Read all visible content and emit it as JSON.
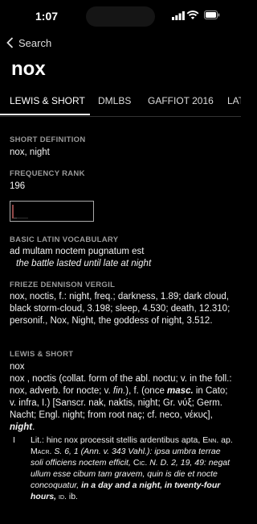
{
  "status": {
    "time": "1:07"
  },
  "nav": {
    "back_label": "Search"
  },
  "headword": "nox",
  "tabs": [
    {
      "label": "LEWIS & SHORT"
    },
    {
      "label": "DMLBS"
    },
    {
      "label": "GAFFIOT 2016"
    },
    {
      "label": "LAT"
    }
  ],
  "sections": {
    "short_def": {
      "label": "SHORT DEFINITION",
      "value": "nox, night"
    },
    "freq": {
      "label": "FREQUENCY RANK",
      "value": "196"
    },
    "vocab": {
      "label": "BASIC LATIN VOCABULARY",
      "latin": "ad multam noctem pugnatum est",
      "english": "the battle lasted until late at night"
    },
    "frieze": {
      "label": "FRIEZE DENNISON VERGIL",
      "value": "nox, noctis, f.: night, freq.; darkness, 1.89; dark cloud, black storm-cloud, 3.198; sleep, 4.530; death, 12.310; personif., Nox, Night, the goddess of night, 3.512."
    },
    "ls": {
      "label": "LEWIS & SHORT",
      "head": "nox",
      "para1a": "nox , noctis (collat. form of the abl. noctu; v. in the foll.: nox, adverb. for nocte; v.",
      "para1b": "fin.",
      "para1c": "), f. (once",
      "para1d": "masc.",
      "para1e": "in Cato; v. infra, I.) [Sanscr. nak, naktis, night; Gr. νύξ; Germ. Nacht; Engl. night; from root naç; cf. neco, νέκυς],",
      "para1f": "night",
      "para1g": ".",
      "num": "I",
      "sub1": "Lit.: hinc nox processit stellis ardentibus apta,",
      "sub2": "Enn.",
      "sub3": "ap.",
      "sub4": "Macr.",
      "sub5": "S. 6, 1 (Ann. v. 343 Vahl.): ipsa umbra terrae soli officiens noctem efficit,",
      "sub6": "Cic.",
      "sub7": "N. D. 2, 19, 49: negat ullum esse cibum tam gravem, quin is die et nocte concoquatur,",
      "sub8": "in a day and a night, in twenty-four hours,",
      "sub9": "id.",
      "sub10": "ib."
    }
  }
}
